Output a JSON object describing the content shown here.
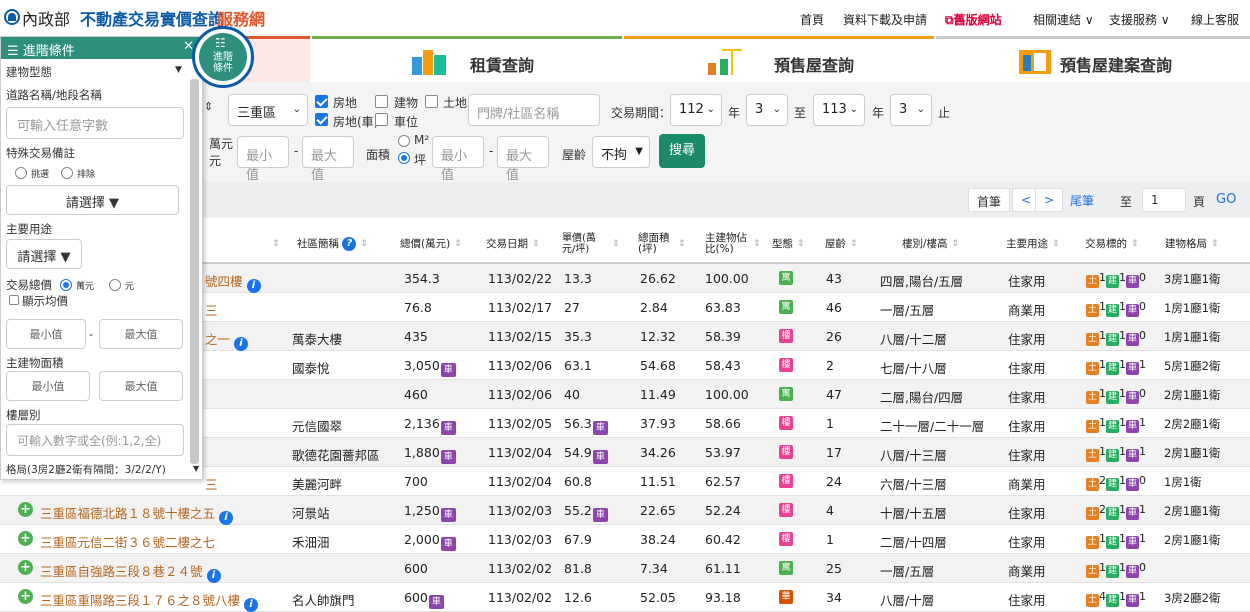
{
  "header": {
    "logo_ministry": "內政部",
    "logo_title": "不動產交易實價查詢",
    "logo_suffix": "服務網",
    "nav": [
      "首頁",
      "資料下載及申請",
      "舊版網站",
      "相關連結 ∨",
      "支援服務 ∨",
      "線上客服"
    ]
  },
  "tabs": [
    {
      "label": "租賃查詢"
    },
    {
      "label": "預售屋查詢"
    },
    {
      "label": "預售屋建案查詢"
    }
  ],
  "filters": {
    "district": "三重區",
    "types": [
      {
        "label": "房地",
        "checked": true
      },
      {
        "label": "建物",
        "checked": false
      },
      {
        "label": "土地",
        "checked": false
      },
      {
        "label": "房地(車)",
        "checked": true
      },
      {
        "label": "車位",
        "checked": false
      }
    ],
    "address_placeholder": "門牌/社區名稱",
    "period_label": "交易期間：",
    "year_from": "112",
    "month_from": "3",
    "to_label": "至",
    "year_to": "113",
    "month_to": "3",
    "year_unit": "年",
    "end_label": "止",
    "price_unit": "萬元",
    "price_unit2": "元",
    "min": "最小值",
    "max": "最大值",
    "area_label": "面積",
    "area_m2": "M²",
    "area_ping": "坪",
    "age_label": "屋齡",
    "age_value": "不拘",
    "search_button": "搜尋"
  },
  "pager": {
    "first": "首筆",
    "prev": "<",
    "next": ">",
    "last": "尾筆",
    "to": "至",
    "page": "1",
    "page_unit": "頁",
    "go": "GO"
  },
  "table": {
    "headers": [
      "社區簡稱",
      "總價(萬元)",
      "交易日期",
      "單價(萬元/坪)",
      "總面積(坪)",
      "主建物佔比(%)",
      "型態",
      "屋齡",
      "樓別/樓高",
      "主要用途",
      "交易標的",
      "建物格局"
    ],
    "rows": [
      {
        "addr": "號四樓",
        "community": "",
        "price": "354.3",
        "date": "113/02/22",
        "unit": "13.3",
        "area": "26.62",
        "main": "100.00",
        "type": "寓",
        "age": "43",
        "floor": "四層,陽台/五層",
        "use": "住家用",
        "t": [
          "1",
          "1",
          "0"
        ],
        "layout": "3房1廳1衛"
      },
      {
        "addr": "三",
        "community": "",
        "price": "76.8",
        "date": "113/02/17",
        "unit": "27",
        "area": "2.84",
        "main": "63.83",
        "type": "寓",
        "age": "46",
        "floor": "一層/五層",
        "use": "商業用",
        "t": [
          "1",
          "1",
          "0"
        ],
        "layout": "1房1廳1衛"
      },
      {
        "addr": "之一",
        "community": "萬泰大樓",
        "price": "435",
        "date": "113/02/15",
        "unit": "35.3",
        "area": "12.32",
        "main": "58.39",
        "type": "樓",
        "age": "26",
        "floor": "八層/十二層",
        "use": "住家用",
        "t": [
          "1",
          "1",
          "0"
        ],
        "layout": "1房1廳1衛"
      },
      {
        "addr": "",
        "community": "國泰悅",
        "price": "3,050",
        "date": "113/02/06",
        "unit": "63.1",
        "area": "54.68",
        "main": "58.43",
        "type": "樓",
        "age": "2",
        "floor": "七層/十八層",
        "use": "住家用",
        "t": [
          "1",
          "1",
          "1"
        ],
        "layout": "5房1廳2衛"
      },
      {
        "addr": "",
        "community": "",
        "price": "460",
        "date": "113/02/06",
        "unit": "40",
        "area": "11.49",
        "main": "100.00",
        "type": "寓",
        "age": "47",
        "floor": "二層,陽台/四層",
        "use": "住家用",
        "t": [
          "1",
          "1",
          "0"
        ],
        "layout": "2房1廳1衛"
      },
      {
        "addr": "",
        "community": "元信國翠",
        "price": "2,136",
        "date": "113/02/05",
        "unit": "56.3",
        "area": "37.93",
        "main": "58.66",
        "type": "樓",
        "age": "1",
        "floor": "二十一層/二十一層",
        "use": "住家用",
        "t": [
          "1",
          "1",
          "1"
        ],
        "layout": "2房2廳1衛"
      },
      {
        "addr": "",
        "community": "歌德花園薔邦區",
        "price": "1,880",
        "date": "113/02/04",
        "unit": "54.9",
        "area": "34.26",
        "main": "53.97",
        "type": "樓",
        "age": "17",
        "floor": "八層/十三層",
        "use": "住家用",
        "t": [
          "1",
          "1",
          "1"
        ],
        "layout": "2房1廳1衛"
      },
      {
        "addr": "三",
        "community": "美麗河畔",
        "price": "700",
        "date": "113/02/04",
        "unit": "60.8",
        "area": "11.51",
        "main": "62.57",
        "type": "樓",
        "age": "24",
        "floor": "六層/十三層",
        "use": "商業用",
        "t": [
          "2",
          "1",
          "0"
        ],
        "layout": "1房1衛"
      },
      {
        "addr": "三重區福德北路１８號十樓之五",
        "community": "河景站",
        "price": "1,250",
        "date": "113/02/03",
        "unit": "55.2",
        "area": "22.65",
        "main": "52.24",
        "type": "樓",
        "age": "4",
        "floor": "十層/十五層",
        "use": "住家用",
        "t": [
          "2",
          "1",
          "1"
        ],
        "layout": "2房1廳1衛"
      },
      {
        "addr": "三重區元信二街３６號二樓之七",
        "community": "禾沺沺",
        "price": "2,000",
        "date": "113/02/03",
        "unit": "67.9",
        "area": "38.24",
        "main": "60.42",
        "type": "樓",
        "age": "1",
        "floor": "二層/十四層",
        "use": "住家用",
        "t": [
          "1",
          "1",
          "1"
        ],
        "layout": "2房1廳1衛"
      },
      {
        "addr": "三重區自強路三段８巷２４號",
        "community": "",
        "price": "600",
        "date": "113/02/02",
        "unit": "81.8",
        "area": "7.34",
        "main": "61.11",
        "type": "寓",
        "age": "25",
        "floor": "一層/五層",
        "use": "商業用",
        "t": [
          "1",
          "1",
          "0"
        ],
        "layout": ""
      },
      {
        "addr": "三重區重陽路三段１７６之８號八樓",
        "community": "名人帥旗門",
        "price": "600",
        "date": "113/02/02",
        "unit": "12.6",
        "area": "52.05",
        "main": "93.18",
        "type": "華",
        "age": "34",
        "floor": "八層/十層",
        "use": "住家用",
        "t": [
          "4",
          "1",
          "1"
        ],
        "layout": "3房2廳2衛"
      }
    ]
  },
  "panel": {
    "title": "進階條件",
    "building_type": "建物型態",
    "road": "道路名稱/地段名稱",
    "road_placeholder": "可輸入任意字數",
    "special": "特殊交易備註",
    "pick": "挑選",
    "exclude": "排除",
    "please_select": "請選擇 ▼",
    "main_use": "主要用途",
    "please_select2": "請選擇 ▼",
    "total_price": "交易總價",
    "wan": "萬元",
    "yuan": "元",
    "show_avg": "顯示均價",
    "min": "最小值",
    "max": "最大值",
    "main_area": "主建物面積",
    "floor": "樓層別",
    "floor_placeholder": "可輸入數字或全(例:1,2,全)",
    "layout": "格局(3房2廳2衛有隔間：3/2/2/Y)",
    "circle_l1": "進階",
    "circle_l2": "條件"
  },
  "colors": {
    "accent": "#2f8f7f",
    "brand": "#0b5aa8",
    "link": "#b5651d"
  }
}
